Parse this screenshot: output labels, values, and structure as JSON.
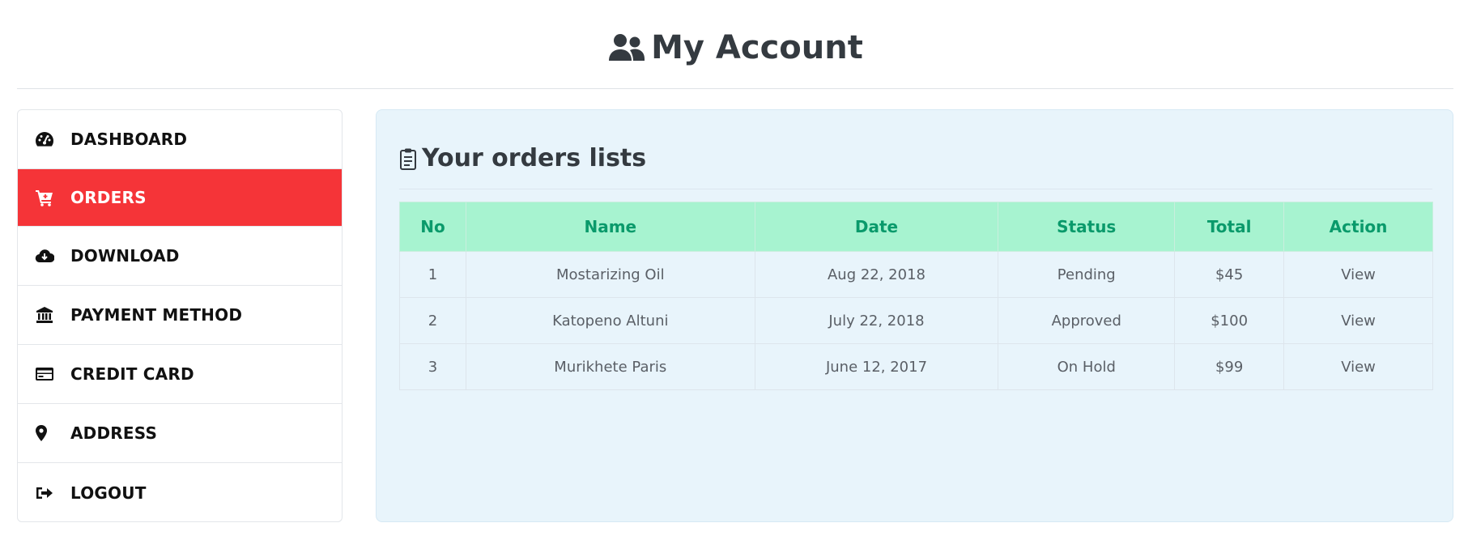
{
  "header": {
    "title": "My Account",
    "icon": "users-icon"
  },
  "sidebar": {
    "items": [
      {
        "label": "DASHBOARD",
        "icon": "dashboard-icon",
        "active": false
      },
      {
        "label": "ORDERS",
        "icon": "cart-icon",
        "active": true
      },
      {
        "label": "DOWNLOAD",
        "icon": "cloud-download-icon",
        "active": false
      },
      {
        "label": "PAYMENT METHOD",
        "icon": "bank-icon",
        "active": false
      },
      {
        "label": "CREDIT CARD",
        "icon": "credit-card-icon",
        "active": false
      },
      {
        "label": "ADDRESS",
        "icon": "map-pin-icon",
        "active": false
      },
      {
        "label": "LOGOUT",
        "icon": "logout-icon",
        "active": false
      }
    ]
  },
  "orders": {
    "title": "Your orders lists",
    "icon": "clipboard-icon",
    "columns": [
      "No",
      "Name",
      "Date",
      "Status",
      "Total",
      "Action"
    ],
    "rows": [
      {
        "no": "1",
        "name": "Mostarizing Oil",
        "date": "Aug 22, 2018",
        "status": "Pending",
        "total": "$45",
        "action": "View"
      },
      {
        "no": "2",
        "name": "Katopeno Altuni",
        "date": "July 22, 2018",
        "status": "Approved",
        "total": "$100",
        "action": "View"
      },
      {
        "no": "3",
        "name": "Murikhete Paris",
        "date": "June 12, 2017",
        "status": "On Hold",
        "total": "$99",
        "action": "View"
      }
    ]
  },
  "colors": {
    "active": "#f53438",
    "table_header_bg": "#a7f3d0",
    "table_header_text": "#0a9a6b",
    "panel_bg": "#e8f4fb"
  }
}
